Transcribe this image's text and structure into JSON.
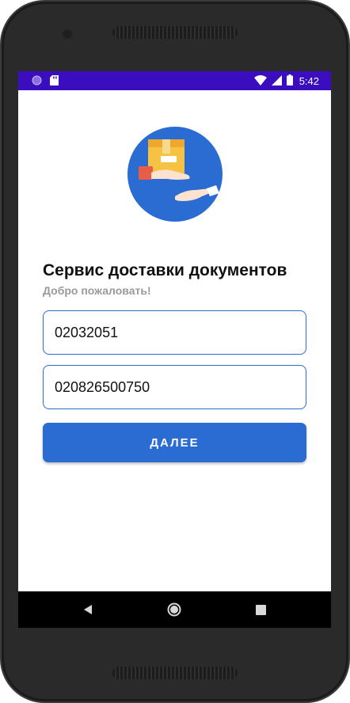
{
  "status_bar": {
    "time": "5:42",
    "background": "#3a0dbf",
    "icons": [
      "circle-icon",
      "sd-card-icon",
      "wifi-icon",
      "signal-icon",
      "battery-icon"
    ]
  },
  "app": {
    "title": "Сервис доставки документов",
    "subtitle": "Добро пожаловать!",
    "logo_icon": "delivery-box-hand-icon",
    "accent_color": "#2a6cd1"
  },
  "form": {
    "field1_value": "02032051",
    "field2_value": "020826500750",
    "next_label": "ДАЛЕЕ"
  },
  "nav_bar": {
    "icons": [
      "back-icon",
      "home-icon",
      "recents-icon"
    ]
  }
}
